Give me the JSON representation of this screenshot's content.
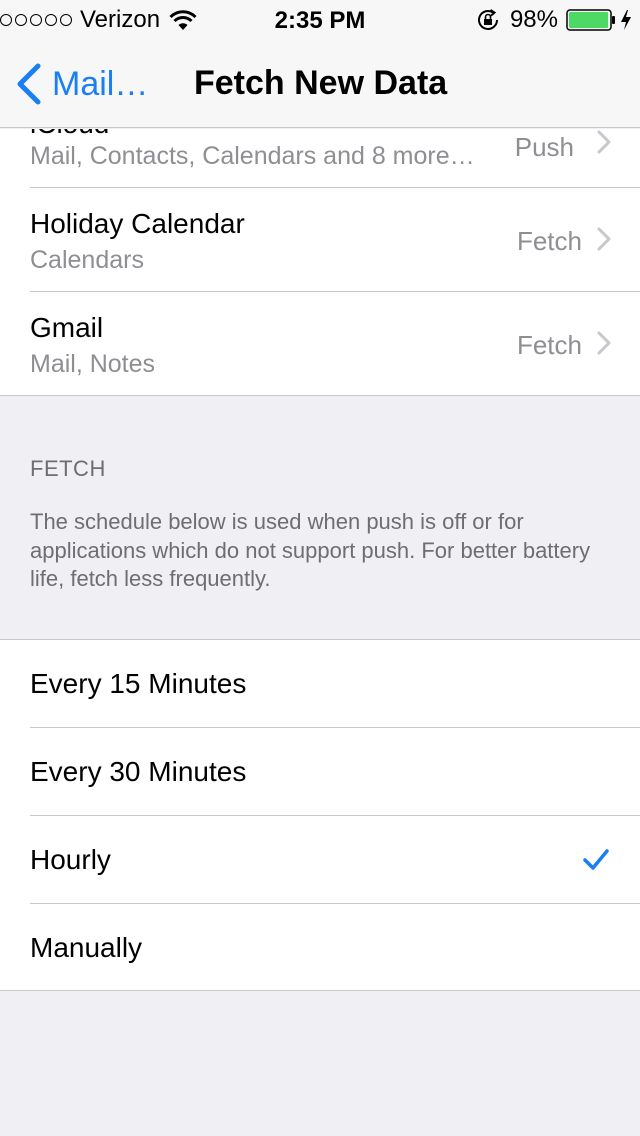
{
  "status_bar": {
    "carrier": "Verizon",
    "time": "2:35 PM",
    "battery_percent": "98%",
    "battery_level": 0.98,
    "icons": [
      "signal-dots",
      "wifi-icon",
      "orientation-lock-icon",
      "battery-icon",
      "charging-bolt-icon"
    ]
  },
  "nav": {
    "back_label": "Mail…",
    "title": "Fetch New Data"
  },
  "accounts": [
    {
      "name": "iCloud",
      "subtitle": "Mail, Contacts, Calendars and 8 more…",
      "value": "Push"
    },
    {
      "name": "Holiday Calendar",
      "subtitle": "Calendars",
      "value": "Fetch"
    },
    {
      "name": "Gmail",
      "subtitle": "Mail, Notes",
      "value": "Fetch"
    }
  ],
  "fetch_section": {
    "title": "FETCH",
    "description": "The schedule below is used when push is off or for applications which do not support push. For better battery life, fetch less frequently."
  },
  "schedule_options": [
    {
      "label": "Every 15 Minutes",
      "selected": false
    },
    {
      "label": "Every 30 Minutes",
      "selected": false
    },
    {
      "label": "Hourly",
      "selected": true
    },
    {
      "label": "Manually",
      "selected": false
    }
  ],
  "colors": {
    "accent": "#1a7ff5",
    "background": "#efeff4",
    "secondary_text": "#8e8e93",
    "battery": "#4cd964"
  }
}
